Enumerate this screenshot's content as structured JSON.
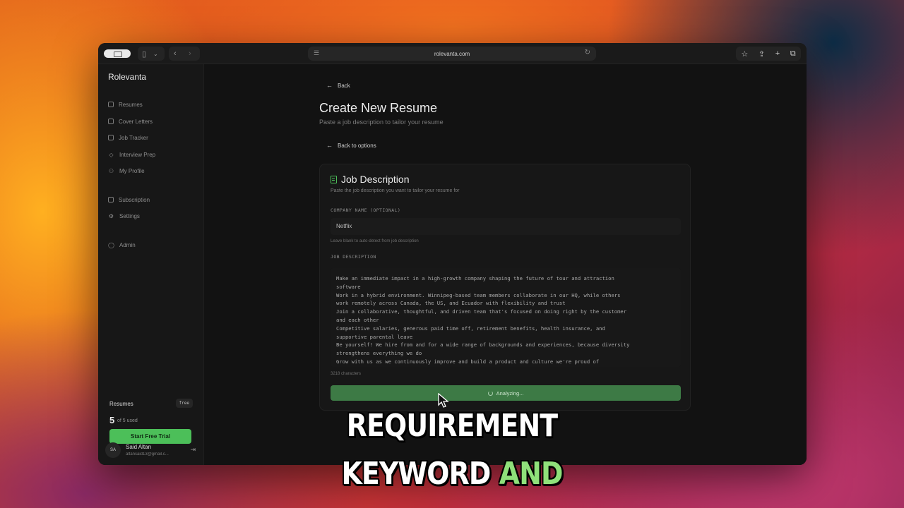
{
  "browser": {
    "url": "rolevanta.com"
  },
  "sidebar": {
    "brand": "Rolevanta",
    "items": [
      {
        "label": "Resumes",
        "icon": "document-icon"
      },
      {
        "label": "Cover Letters",
        "icon": "mail-icon"
      },
      {
        "label": "Job Tracker",
        "icon": "briefcase-icon"
      },
      {
        "label": "Interview Prep",
        "icon": "graduation-cap-icon"
      },
      {
        "label": "My Profile",
        "icon": "user-icon"
      },
      {
        "label": "Subscription",
        "icon": "credit-card-icon"
      },
      {
        "label": "Settings",
        "icon": "gear-icon"
      },
      {
        "label": "Admin",
        "icon": "shield-icon"
      }
    ],
    "usage": {
      "title": "Resumes",
      "badge": "free",
      "count": "5",
      "of_text": "of 5 used",
      "trial_button": "Start Free Trial"
    },
    "user": {
      "initials": "SA",
      "name": "Said Altan",
      "email": "altansaid13@gmail.c..."
    }
  },
  "main": {
    "back_label": "Back",
    "title": "Create New Resume",
    "subtitle": "Paste a job description to tailor your resume",
    "back_options_label": "Back to options",
    "card": {
      "title": "Job Description",
      "subtitle": "Paste the job description you want to tailor your resume for",
      "company_label": "COMPANY NAME (OPTIONAL)",
      "company_value": "Netflix",
      "company_hint": "Leave blank to auto-detect from job description",
      "job_label": "JOB DESCRIPTION",
      "job_text": "Make an immediate impact in a high-growth company shaping the future of tour and attraction\nsoftware\nWork in a hybrid environment. Winnipeg-based team members collaborate in our HQ, while others\nwork remotely across Canada, the US, and Ecuador with flexibility and trust\nJoin a collaborative, thoughtful, and driven team that's focused on doing right by the customer\nand each other\nCompetitive salaries, generous paid time off, retirement benefits, health insurance, and\nsupportive parental leave\nBe yourself! We hire from and for a wide range of backgrounds and experiences, because diversity\nstrengthens everything we do\nGrow with us as we continuously improve and build a product and culture we're proud of",
      "char_count": "3218 characters",
      "analyze_button": "Analyzing..."
    }
  },
  "caption": {
    "line1": "REQUIREMENT",
    "line2_white": "KEYWORD",
    "line2_green": "AND",
    "green_color": "#8fe07a"
  }
}
